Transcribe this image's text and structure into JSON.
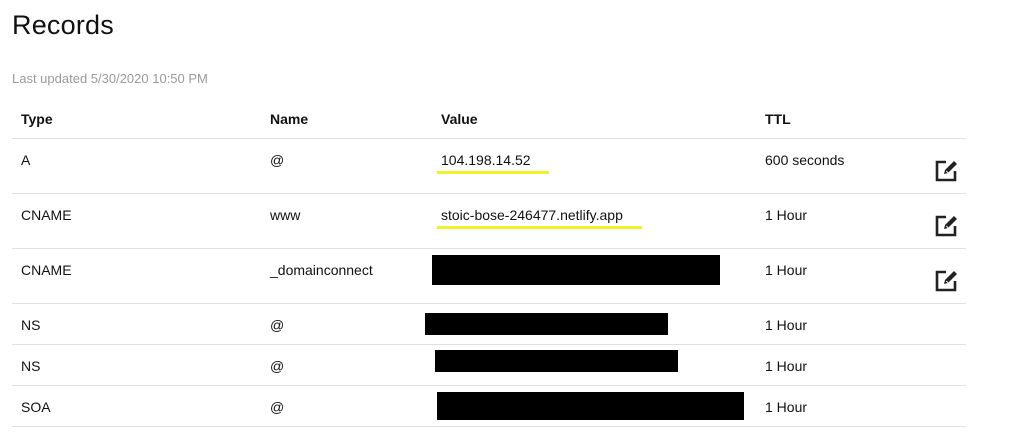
{
  "page": {
    "title": "Records",
    "last_updated": "Last updated 5/30/2020 10:50 PM"
  },
  "table": {
    "headers": {
      "type": "Type",
      "name": "Name",
      "value": "Value",
      "ttl": "TTL"
    },
    "rows": [
      {
        "type": "A",
        "name": "@",
        "value": "104.198.14.52",
        "value_redacted": false,
        "value_highlighted": true,
        "ttl": "600 seconds",
        "editable": true
      },
      {
        "type": "CNAME",
        "name": "www",
        "value": "stoic-bose-246477.netlify.app",
        "value_redacted": false,
        "value_highlighted": true,
        "ttl": "1 Hour",
        "editable": true
      },
      {
        "type": "CNAME",
        "name": "_domainconnect",
        "value": "",
        "value_redacted": true,
        "value_highlighted": false,
        "ttl": "1 Hour",
        "editable": true
      },
      {
        "type": "NS",
        "name": "@",
        "value": "",
        "value_redacted": true,
        "value_highlighted": false,
        "ttl": "1 Hour",
        "editable": false
      },
      {
        "type": "NS",
        "name": "@",
        "value": "",
        "value_redacted": true,
        "value_highlighted": false,
        "ttl": "1 Hour",
        "editable": false
      },
      {
        "type": "SOA",
        "name": "@",
        "value": "",
        "value_redacted": true,
        "value_highlighted": false,
        "ttl": "1 Hour",
        "editable": false
      }
    ]
  },
  "icons": {
    "edit": "edit-icon"
  },
  "colors": {
    "highlight": "#f2f22a",
    "redaction": "#000000",
    "muted_text": "#9a9a9a",
    "divider": "#e0e0e0"
  }
}
